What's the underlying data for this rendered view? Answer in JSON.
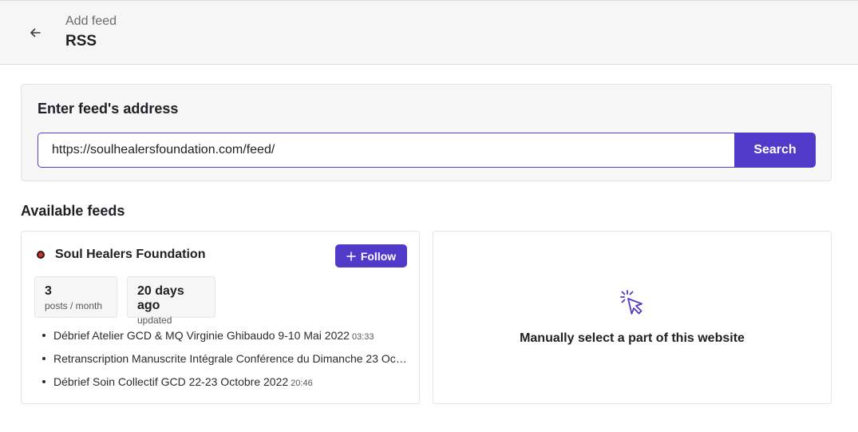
{
  "header": {
    "back_icon": "arrow-left-icon",
    "subtitle": "Add feed",
    "title": "RSS"
  },
  "search": {
    "label": "Enter feed's address",
    "value": "https://soulhealersfoundation.com/feed/",
    "button_label": "Search",
    "accent_color": "#5139c9"
  },
  "available": {
    "title": "Available feeds"
  },
  "feed": {
    "name": "Soul Healers Foundation",
    "favicon_icon": "site-favicon-icon",
    "follow_label": "Follow",
    "follow_icon": "plus-icon",
    "stats": [
      {
        "value": "3",
        "label": "posts / month"
      },
      {
        "value": "20 days ago",
        "label": "updated"
      }
    ],
    "items": [
      {
        "title": "Débrief Atelier GCD & MQ Virginie Ghibaudo 9-10 Mai 2022",
        "time": "03:33"
      },
      {
        "title": "Retranscription Manuscrite Intégrale Conférence du Dimanche 23 Oc…",
        "time": ""
      },
      {
        "title": "Débrief Soin Collectif GCD 22-23 Octobre 2022",
        "time": "20:46"
      }
    ]
  },
  "manual": {
    "icon": "cursor-click-icon",
    "label": "Manually select a part of this website"
  }
}
